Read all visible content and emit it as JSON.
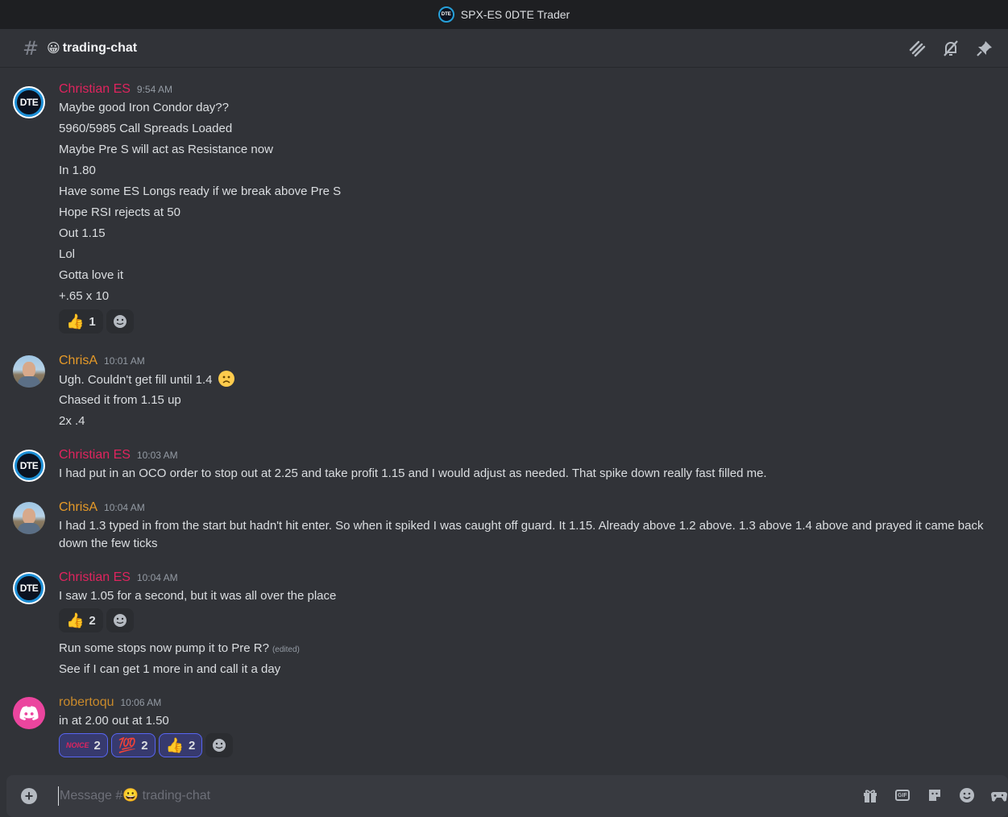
{
  "window": {
    "title": "SPX-ES 0DTE Trader",
    "server_icon_text": "DTE"
  },
  "channel": {
    "hash": "#",
    "emoji": "😀",
    "name": "trading-chat"
  },
  "messages": [
    {
      "author": "Christian ES",
      "time": "9:54 AM",
      "avatar": "DTE",
      "lines": [
        "Maybe good Iron Condor day??",
        "5960/5985 Call Spreads Loaded",
        "Maybe Pre S will act as Resistance now",
        "In 1.80",
        "Have some ES Longs ready if we break above Pre S",
        "Hope RSI rejects at 50",
        "Out 1.15",
        "Lol",
        "Gotta love it",
        "+.65 x 10"
      ],
      "reactions": [
        {
          "emoji": "👍",
          "count": "1"
        }
      ]
    },
    {
      "author": "ChrisA",
      "time": "10:01 AM",
      "lines": [
        "Ugh. Couldn't get fill until 1.4",
        "Chased it from 1.15 up",
        "2x .4"
      ]
    },
    {
      "author": "Christian ES",
      "time": "10:03 AM",
      "avatar": "DTE",
      "lines": [
        "I had put in an OCO order to stop out at 2.25 and take profit 1.15 and I would adjust as needed. That spike down really fast filled me."
      ]
    },
    {
      "author": "ChrisA",
      "time": "10:04 AM",
      "lines": [
        "I had 1.3 typed in from the start but hadn't hit enter.  So when it spiked I was caught off guard.   It 1.15. Already above 1.2 above. 1.3 above 1.4 above and prayed it came back down the few ticks"
      ]
    },
    {
      "author": "Christian ES",
      "time": "10:04 AM",
      "avatar": "DTE",
      "lines": [
        "I saw 1.05 for a second, but it was all over the place"
      ],
      "reactions": [
        {
          "emoji": "👍",
          "count": "2"
        }
      ],
      "followups": [
        "Run some stops now pump it to Pre R?",
        "See if I can get 1 more in and call it a day"
      ],
      "edited_label": "(edited)"
    },
    {
      "author": "robertoqu",
      "time": "10:06 AM",
      "lines": [
        "in at 2.00 out at 1.50"
      ],
      "reactions": [
        {
          "emoji": "NOICE",
          "count": "2"
        },
        {
          "emoji": "💯",
          "count": "2"
        },
        {
          "emoji": "👍",
          "count": "2"
        }
      ]
    }
  ],
  "composer": {
    "placeholder": "Message #😀 trading-chat"
  }
}
